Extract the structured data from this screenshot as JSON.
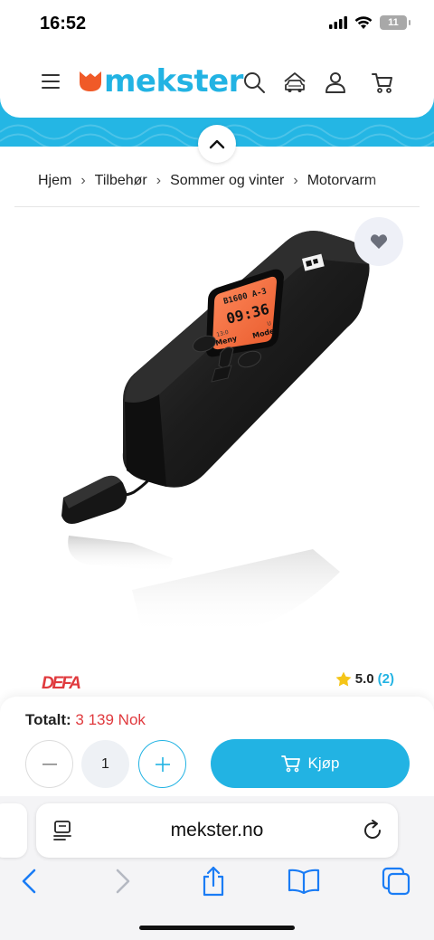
{
  "status_bar": {
    "time": "16:52",
    "battery_level": "11",
    "icons": [
      "signal-icon",
      "wifi-icon",
      "battery-icon"
    ]
  },
  "header": {
    "logo_text": "mekster",
    "icons": [
      "menu-icon",
      "search-icon",
      "car-icon",
      "user-icon",
      "cart-icon"
    ],
    "colors": {
      "brand": "#22b3e3",
      "logo_mark": "#f05a28"
    }
  },
  "breadcrumb": {
    "items": [
      "Hjem",
      "Tilbehør",
      "Sommer og vinter",
      "Motorvarm"
    ]
  },
  "product": {
    "device_display": {
      "line1": "B1600 A-3",
      "time": "09:36",
      "left_label": "Meny",
      "right_label": "Mode",
      "left_hint": "13:0",
      "right_hint": "U"
    },
    "brand": "DEFA",
    "rating_score": "5.0",
    "rating_count": "(2)"
  },
  "buy_panel": {
    "total_label": "Totalt:",
    "total_price": "3 139 Nok",
    "quantity": "1",
    "buy_label": "Kjøp",
    "price_color": "#e03a3e"
  },
  "browser": {
    "url": "mekster.no",
    "icons": [
      "reader-icon",
      "reload-icon",
      "back-icon",
      "forward-icon",
      "share-icon",
      "bookmarks-icon",
      "tabs-icon"
    ]
  }
}
